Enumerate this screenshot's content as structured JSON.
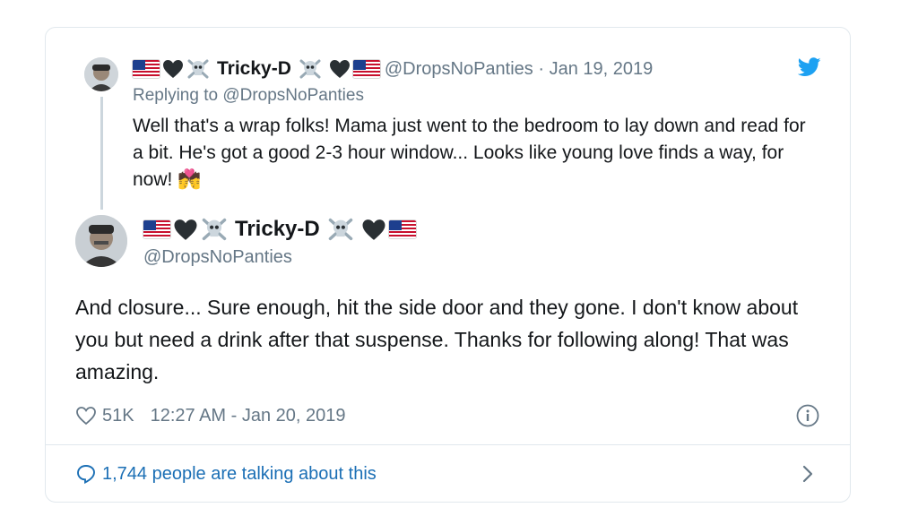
{
  "icons": {
    "brand": "twitter-bird-icon",
    "like": "heart-outline-icon",
    "info": "info-icon",
    "talk": "speech-bubble-icon",
    "more": "chevron-right-icon",
    "flag": "us-flag-icon",
    "heart": "black-heart-icon",
    "skull": "skull-crossbones-icon",
    "emoji": "couple-with-heart-icon"
  },
  "colors": {
    "brand_blue": "#1da1f2",
    "link_blue": "#1b6fb5",
    "text": "#14171a",
    "muted": "#657786",
    "border": "#e1e8ed"
  },
  "parent_tweet": {
    "display_name": "Tricky-D",
    "handle_date": "@DropsNoPanties · Jan 19, 2019",
    "replying_to": "Replying to @DropsNoPanties",
    "text": "Well that's a wrap folks! Mama just went to the bedroom to lay down and read for a bit.  He's got a good 2-3 hour window... Looks like young love finds a way, for now! 💏"
  },
  "main_tweet": {
    "display_name": "Tricky-D",
    "handle": "@DropsNoPanties",
    "text": "And closure... Sure enough, hit the side door and they gone.  I don't know about you but need a drink after that suspense.  Thanks for following along! That was amazing.",
    "likes": "51K",
    "timestamp": "12:27 AM - Jan 20, 2019"
  },
  "footer": {
    "talking": "1,744 people are talking about this"
  }
}
